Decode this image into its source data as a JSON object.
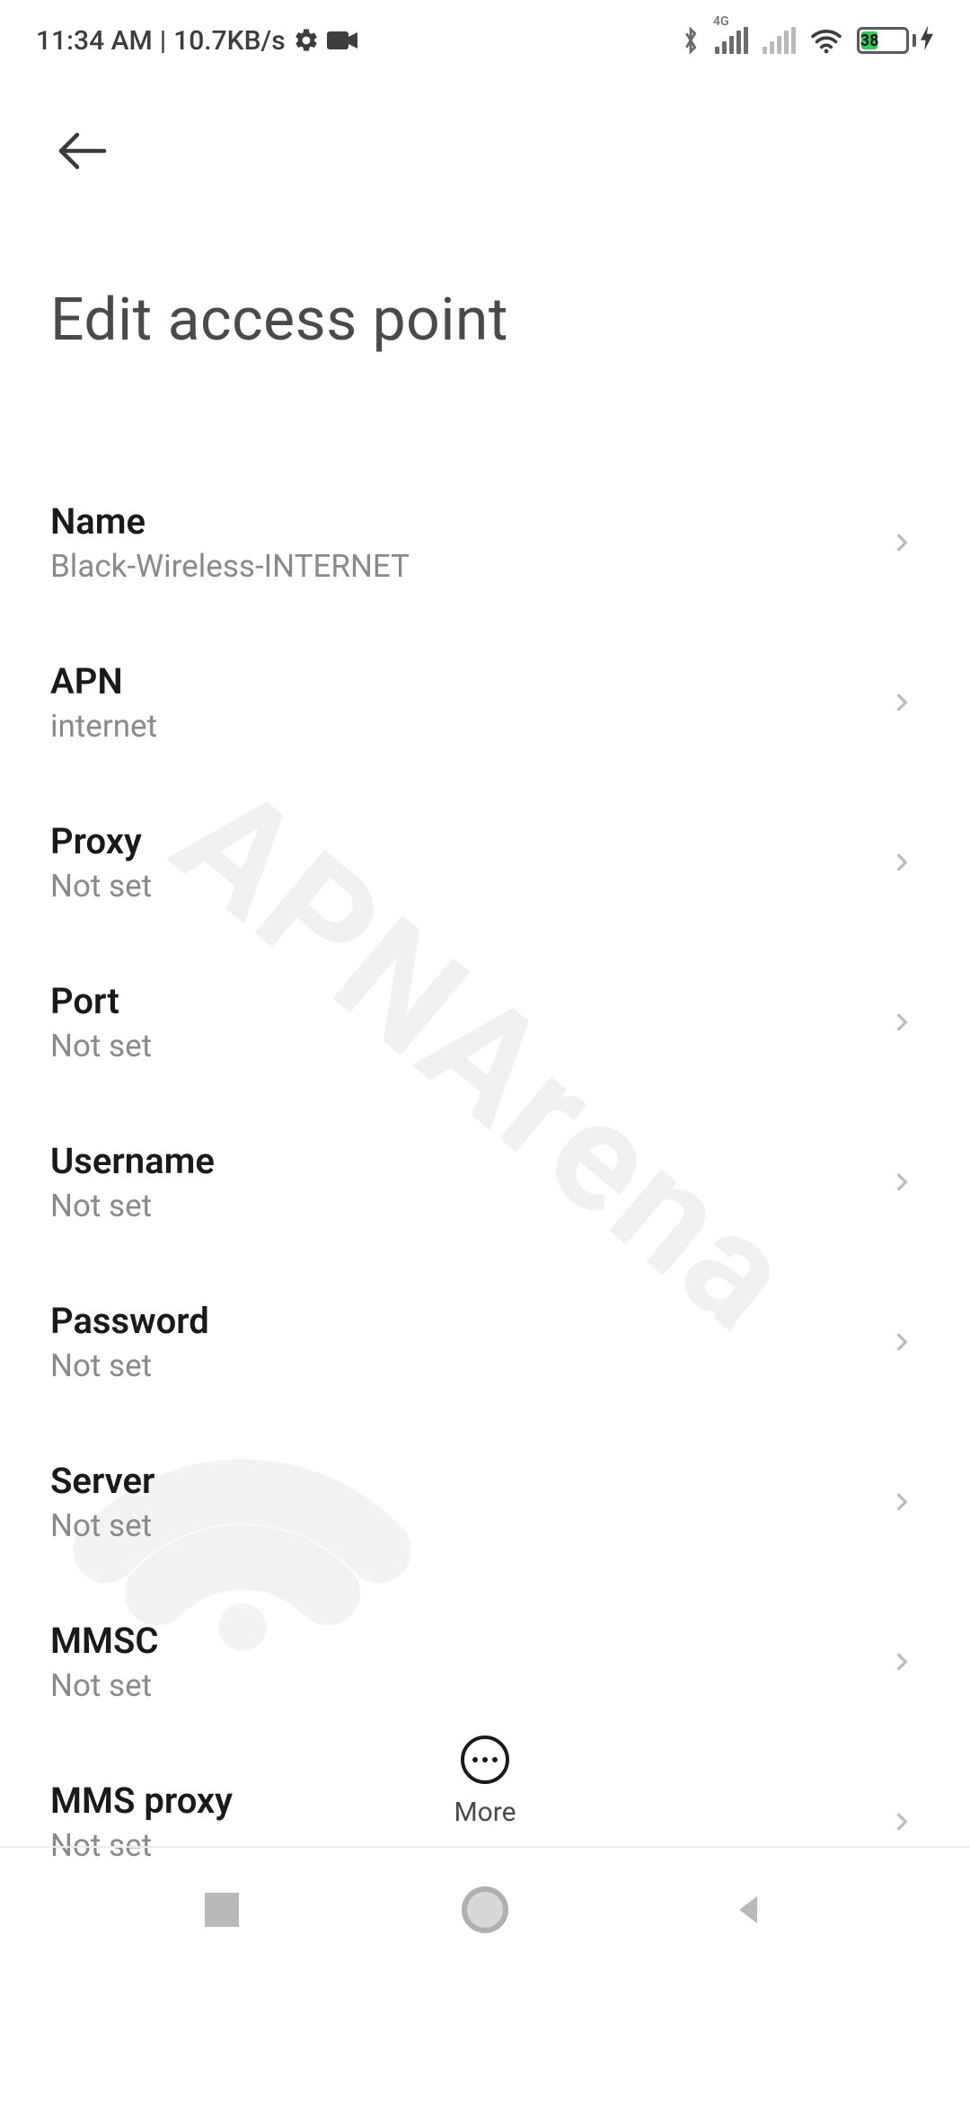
{
  "status": {
    "time": "11:34 AM",
    "separator": "|",
    "net_speed": "10.7KB/s",
    "signal_label": "4G",
    "battery_pct": "38"
  },
  "header": {
    "title": "Edit access point"
  },
  "settings": [
    {
      "label": "Name",
      "value": "Black-Wireless-INTERNET"
    },
    {
      "label": "APN",
      "value": "internet"
    },
    {
      "label": "Proxy",
      "value": "Not set"
    },
    {
      "label": "Port",
      "value": "Not set"
    },
    {
      "label": "Username",
      "value": "Not set"
    },
    {
      "label": "Password",
      "value": "Not set"
    },
    {
      "label": "Server",
      "value": "Not set"
    },
    {
      "label": "MMSC",
      "value": "Not set"
    },
    {
      "label": "MMS proxy",
      "value": "Not set"
    }
  ],
  "bottom": {
    "more_label": "More"
  },
  "watermark": "APNArena"
}
